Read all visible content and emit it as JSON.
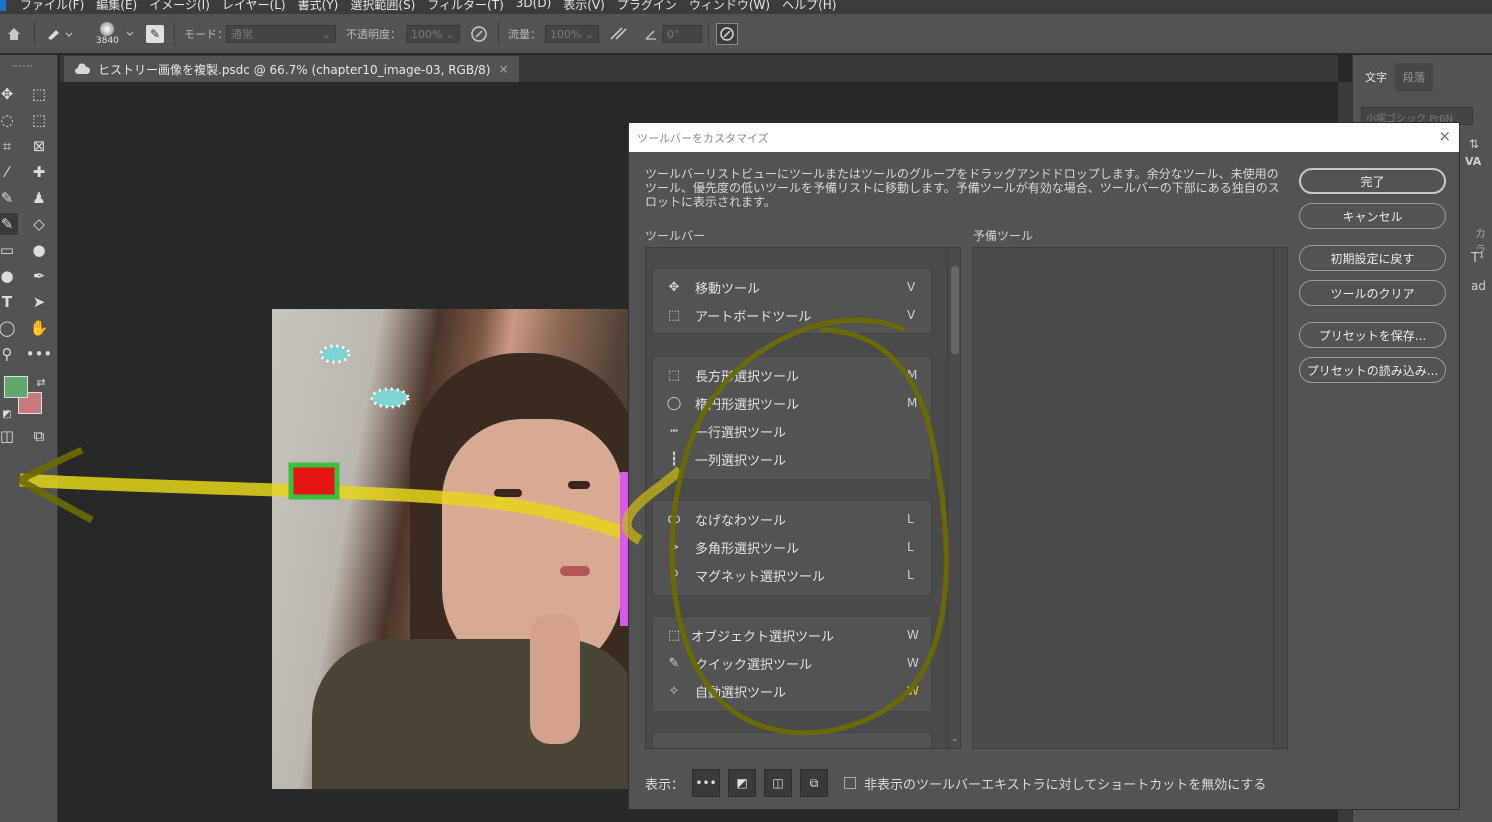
{
  "menubar": {
    "items": [
      "ファイル(F)",
      "編集(E)",
      "イメージ(I)",
      "レイヤー(L)",
      "書式(Y)",
      "選択範囲(S)",
      "フィルター(T)",
      "3D(D)",
      "表示(V)",
      "プラグイン",
      "ウィンドウ(W)",
      "ヘルプ(H)"
    ]
  },
  "options_bar": {
    "brush_size": "3840",
    "mode_label": "モード：",
    "mode_value": "通常",
    "opacity_label": "不透明度：",
    "opacity_value": "100%",
    "flow_label": "流量：",
    "flow_value": "100%",
    "angle_value": "0°"
  },
  "document_tab": {
    "title": "ヒストリー画像を複製.psdc @ 66.7% (chapter10_image-03, RGB/8)",
    "close": "×"
  },
  "right_panel": {
    "tabs": [
      "文字",
      "段落"
    ],
    "font_value": "小塚ゴシック Pr6N",
    "color_label": "カラ"
  },
  "colors": {
    "foreground": "#5fa86a",
    "background": "#c97a7c",
    "annotation_yellow": "#e6d51a",
    "annotation_olive": "#6e6a00",
    "annotation_green": "#38c13a",
    "annotation_red": "#e51515",
    "annotation_magenta": "#d958f0"
  },
  "dialog": {
    "title": "ツールバーをカスタマイズ",
    "close": "×",
    "description": "ツールバーリストビューにツールまたはツールのグループをドラッグアンドドロップします。余分なツール、未使用のツール、優先度の低いツールを予備リストに移動します。予備ツールが有効な場合、ツールバーの下部にある独自のスロットに表示されます。",
    "toolbar_label": "ツールバー",
    "reserve_label": "予備ツール",
    "groups": [
      {
        "tools": [
          {
            "icon": "move-icon",
            "glyph": "✥",
            "name": "移動ツール",
            "shortcut": "V"
          },
          {
            "icon": "artboard-icon",
            "glyph": "⬚",
            "name": "アートボードツール",
            "shortcut": "V"
          }
        ]
      },
      {
        "tools": [
          {
            "icon": "rect-marquee-icon",
            "glyph": "⬚",
            "name": "長方形選択ツール",
            "shortcut": "M"
          },
          {
            "icon": "ellipse-marquee-icon",
            "glyph": "◯",
            "name": "楕円形選択ツール",
            "shortcut": "M"
          },
          {
            "icon": "single-row-marquee-icon",
            "glyph": "┅",
            "name": "一行選択ツール",
            "shortcut": ""
          },
          {
            "icon": "single-column-marquee-icon",
            "glyph": "┇",
            "name": "一列選択ツール",
            "shortcut": ""
          }
        ]
      },
      {
        "tools": [
          {
            "icon": "lasso-icon",
            "glyph": "ꝏ",
            "name": "なげなわツール",
            "shortcut": "L"
          },
          {
            "icon": "polygonal-lasso-icon",
            "glyph": "⊳",
            "name": "多角形選択ツール",
            "shortcut": "L"
          },
          {
            "icon": "magnetic-lasso-icon",
            "glyph": "⚲",
            "name": "マグネット選択ツール",
            "shortcut": "L"
          }
        ]
      },
      {
        "tools": [
          {
            "icon": "object-selection-icon",
            "glyph": "⬚",
            "name": "オブジェクト選択ツール",
            "shortcut": "W"
          },
          {
            "icon": "quick-selection-icon",
            "glyph": "✎",
            "name": "クイック選択ツール",
            "shortcut": "W"
          },
          {
            "icon": "magic-wand-icon",
            "glyph": "✧",
            "name": "自動選択ツール",
            "shortcut": "W"
          }
        ]
      }
    ],
    "buttons": {
      "done": "完了",
      "cancel": "キャンセル",
      "restore_defaults": "初期設定に戻す",
      "clear_tools": "ツールのクリア",
      "save_preset": "プリセットを保存...",
      "load_preset": "プリセットの読み込み..."
    },
    "footer": {
      "show_label": "表示：",
      "disable_shortcuts_label": "非表示のツールバーエキストラに対してショートカットを無効にする"
    }
  }
}
